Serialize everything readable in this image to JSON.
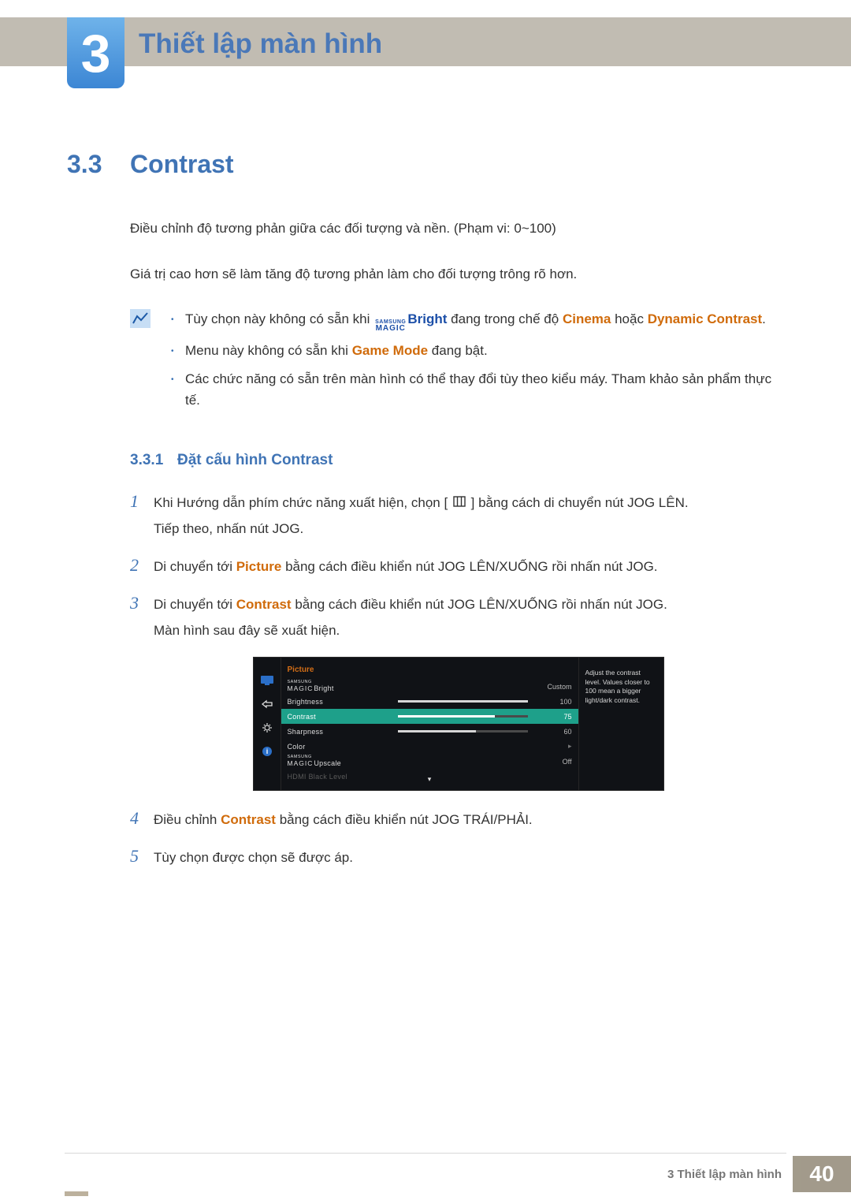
{
  "chapter": {
    "number": "3",
    "title": "Thiết lập màn hình"
  },
  "section": {
    "number": "3.3",
    "title": "Contrast"
  },
  "para1": "Điều chỉnh độ tương phản giữa các đối tượng và nền. (Phạm vi: 0~100)",
  "para2": "Giá trị cao hơn sẽ làm tăng độ tương phản làm cho đối tượng trông rõ hơn.",
  "notes": {
    "item1_pre": "Tùy chọn này không có sẵn khi ",
    "magic_sup": "SAMSUNG",
    "magic_main": "MAGIC",
    "item1_bright": "Bright",
    "item1_mid": " đang trong chế độ ",
    "item1_cinema": "Cinema",
    "item1_or": " hoặc ",
    "item1_dc": "Dynamic Contrast",
    "item1_end": ".",
    "item2_pre": "Menu này không có sẵn khi ",
    "item2_gm": "Game Mode",
    "item2_end": " đang bật.",
    "item3": "Các chức năng có sẵn trên màn hình có thể thay đổi tùy theo kiểu máy. Tham khảo sản phẩm thực tế."
  },
  "sub": {
    "number": "3.3.1",
    "title": "Đặt cấu hình Contrast"
  },
  "steps": {
    "s1a": "Khi Hướng dẫn phím chức năng xuất hiện, chọn [",
    "s1b": "] bằng cách di chuyển nút JOG LÊN.",
    "s1c": "Tiếp theo, nhấn nút JOG.",
    "s2a": "Di chuyển tới ",
    "s2_word": "Picture",
    "s2b": " bằng cách điều khiển nút JOG LÊN/XUỐNG rồi nhấn nút JOG.",
    "s3a": "Di chuyển tới ",
    "s3_word": "Contrast",
    "s3b": " bằng cách điều khiển nút JOG LÊN/XUỐNG rồi nhấn nút JOG.",
    "s3c": "Màn hình sau đây sẽ xuất hiện.",
    "s4a": "Điều chỉnh ",
    "s4_word": "Contrast",
    "s4b": " bằng cách điều khiển nút JOG TRÁI/PHẢI.",
    "s5": "Tùy chọn được chọn sẽ được áp."
  },
  "osd": {
    "title": "Picture",
    "rows": [
      {
        "label_type": "magic",
        "suffix": "Bright",
        "value": "Custom",
        "bar": null
      },
      {
        "label": "Brightness",
        "value": "100",
        "bar": 100
      },
      {
        "label": "Contrast",
        "value": "75",
        "bar": 75,
        "selected": true
      },
      {
        "label": "Sharpness",
        "value": "60",
        "bar": 60
      },
      {
        "label": "Color",
        "arrow": true
      },
      {
        "label_type": "magic",
        "suffix": "Upscale",
        "value": "Off"
      },
      {
        "label": "HDMI Black Level",
        "dim": true
      }
    ],
    "side": "Adjust the contrast level. Values closer to 100 mean a bigger light/dark contrast."
  },
  "footer": {
    "label": "3 Thiết lập màn hình",
    "page": "40"
  }
}
